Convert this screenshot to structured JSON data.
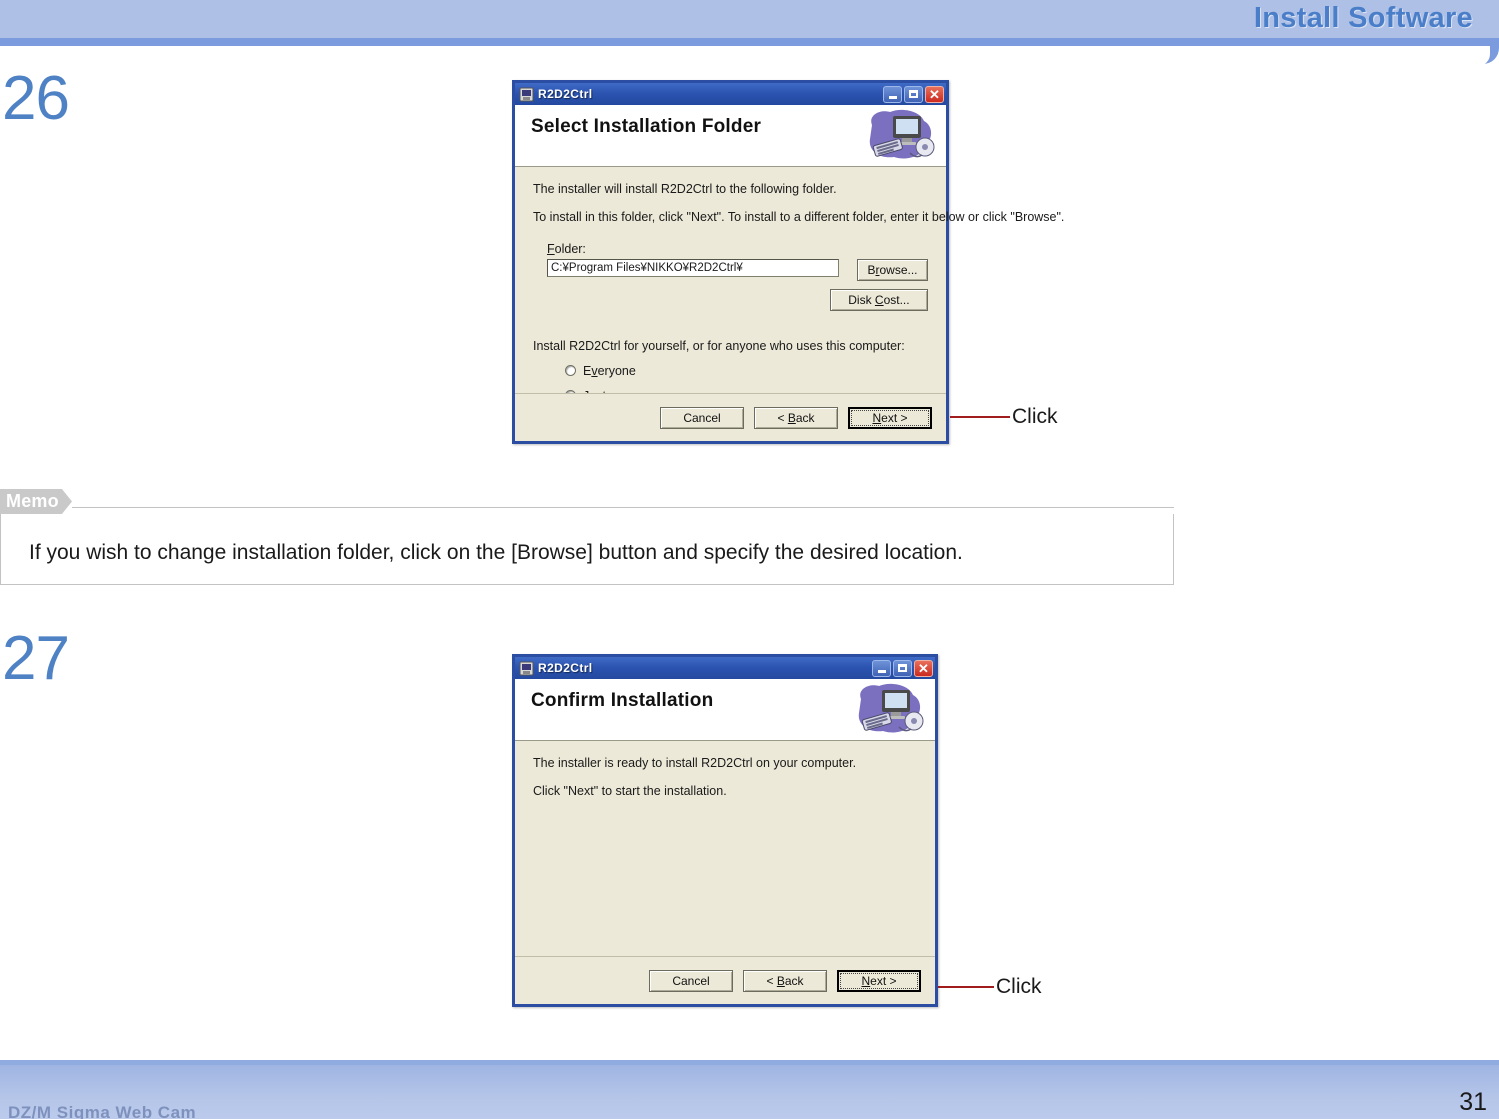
{
  "header": {
    "title": "Install Software"
  },
  "steps": [
    {
      "number": "26"
    },
    {
      "number": "27"
    }
  ],
  "dialog1": {
    "titlebar": {
      "title": "R2D2Ctrl",
      "icon": "installer-icon",
      "minimize": "–",
      "maximize": "□",
      "close": "✕"
    },
    "banner_title": "Select Installation Folder",
    "banner_art": "computer-cd-art",
    "line1": "The installer will install R2D2Ctrl to the following folder.",
    "line2": "To install in this folder, click \"Next\". To install to a different folder, enter it below or click \"Browse\".",
    "folder_label": "Folder:",
    "folder_value": "C:¥Program Files¥NIKKO¥R2D2Ctrl¥",
    "browse_label": "Browse...",
    "diskcost_label": "Disk Cost...",
    "radio_intro": "Install R2D2Ctrl for yourself, or for anyone who uses this computer:",
    "radios": [
      {
        "label": "Everyone",
        "checked": false
      },
      {
        "label": "Just me",
        "checked": true
      }
    ],
    "buttons": {
      "cancel": "Cancel",
      "back": "< Back",
      "next": "Next >"
    },
    "callout": "Click"
  },
  "memo": {
    "tab_label": "Memo",
    "text": "If you wish to change installation folder, click on the [Browse] button and specify the desired location."
  },
  "dialog2": {
    "titlebar": {
      "title": "R2D2Ctrl",
      "icon": "installer-icon",
      "minimize": "–",
      "maximize": "□",
      "close": "✕"
    },
    "banner_title": "Confirm Installation",
    "banner_art": "computer-cd-art",
    "line1": "The installer is ready to install R2D2Ctrl on your computer.",
    "line2": "Click \"Next\" to start the installation.",
    "buttons": {
      "cancel": "Cancel",
      "back": "< Back",
      "next": "Next >"
    },
    "callout": "Click"
  },
  "footer": {
    "document_name": "DZ/M Sigma Web Cam",
    "page_number": "31"
  },
  "colors": {
    "header_band": "#aec0e6",
    "header_rule": "#7c9ade",
    "title_blue": "#4a7ec8",
    "step_blue": "#4e82c4",
    "callout_red": "#a11d1d",
    "dialog_border": "#2b4ea2",
    "dialog_face": "#ece9d8"
  }
}
